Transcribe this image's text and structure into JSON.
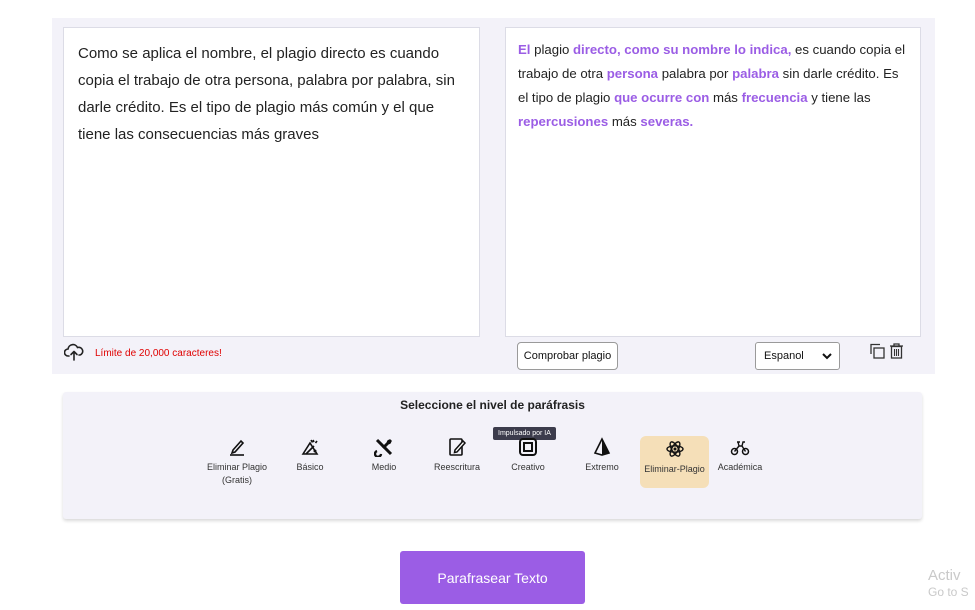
{
  "input": {
    "text": "Como se aplica el nombre, el plagio directo es cuando copia el trabajo de otra persona, palabra por palabra, sin darle crédito. Es el tipo de plagio más común y el que tiene las consecuencias más graves"
  },
  "output": {
    "segments": [
      {
        "t": "El",
        "h": true
      },
      {
        "t": " plagio ",
        "h": false
      },
      {
        "t": "directo, como su nombre lo indica,",
        "h": true
      },
      {
        "t": " es cuando copia el trabajo de otra ",
        "h": false
      },
      {
        "t": "persona",
        "h": true
      },
      {
        "t": " palabra por ",
        "h": false
      },
      {
        "t": "palabra",
        "h": true
      },
      {
        "t": " sin darle crédito. Es el tipo de plagio ",
        "h": false
      },
      {
        "t": "que ocurre con",
        "h": true
      },
      {
        "t": " más ",
        "h": false
      },
      {
        "t": "frecuencia",
        "h": true
      },
      {
        "t": " y tiene las ",
        "h": false
      },
      {
        "t": "repercusiones",
        "h": true
      },
      {
        "t": " más ",
        "h": false
      },
      {
        "t": "severas.",
        "h": true
      }
    ]
  },
  "footer": {
    "limit_text": "Límite de 20,000 caracteres!",
    "check_button": "Comprobar plagio",
    "language_value": "Espanol"
  },
  "levels": {
    "title": "Seleccione el nivel de paráfrasis",
    "ai_badge": "Impulsado por IA",
    "modes": [
      {
        "label": "Eliminar Plagio",
        "sub": "(Gratis)",
        "icon": "pen-icon"
      },
      {
        "label": "Básico",
        "icon": "magic-tools-icon"
      },
      {
        "label": "Medio",
        "icon": "cross-tools-icon"
      },
      {
        "label": "Reescritura",
        "icon": "edit-page-icon"
      },
      {
        "label": "Creativo",
        "icon": "frame-icon"
      },
      {
        "label": "Extremo",
        "icon": "pyramid-icon"
      },
      {
        "label": "Eliminar-Plagio",
        "icon": "atom-icon",
        "active": true
      },
      {
        "label": "Académica",
        "icon": "scooter-icon"
      }
    ]
  },
  "actions": {
    "paraphrase_button": "Parafrasear Texto"
  },
  "watermark": {
    "line1": "Activ",
    "line2": "Go to S"
  },
  "colors": {
    "accent": "#9b5de5",
    "active_mode_bg": "#f5dfb8",
    "limit_red": "#e00000"
  }
}
